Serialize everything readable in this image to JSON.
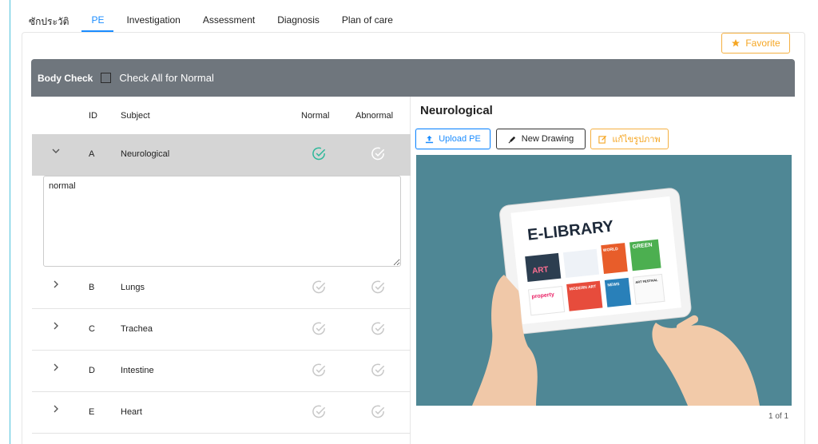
{
  "tabs": [
    {
      "label": "ซักประวัติ",
      "active": false
    },
    {
      "label": "PE",
      "active": true
    },
    {
      "label": "Investigation",
      "active": false
    },
    {
      "label": "Assessment",
      "active": false
    },
    {
      "label": "Diagnosis",
      "active": false
    },
    {
      "label": "Plan of care",
      "active": false
    }
  ],
  "favorite": {
    "label": "Favorite",
    "icon": "star-icon"
  },
  "body_check": {
    "title": "Body Check",
    "check_all_label": "Check All for Normal",
    "checked": false
  },
  "table": {
    "headers": {
      "id": "ID",
      "subject": "Subject",
      "normal": "Normal",
      "abnormal": "Abnormal"
    },
    "rows": [
      {
        "id": "A",
        "subject": "Neurological",
        "expanded": true,
        "normal": true,
        "abnormal": false,
        "note": "normal"
      },
      {
        "id": "B",
        "subject": "Lungs",
        "expanded": false,
        "normal": false,
        "abnormal": false
      },
      {
        "id": "C",
        "subject": "Trachea",
        "expanded": false,
        "normal": false,
        "abnormal": false
      },
      {
        "id": "D",
        "subject": "Intestine",
        "expanded": false,
        "normal": false,
        "abnormal": false
      },
      {
        "id": "E",
        "subject": "Heart",
        "expanded": false,
        "normal": false,
        "abnormal": false
      }
    ]
  },
  "right_panel": {
    "title": "Neurological",
    "upload_label": "Upload PE",
    "drawing_label": "New Drawing",
    "edit_label": "แก้ไขรูปภาพ",
    "image_title": "E-LIBRARY",
    "image_tiles": [
      "ART",
      "WORLD",
      "GREEN",
      "property",
      "MODERN ART",
      "NEWS",
      "ART FESTIVAL"
    ],
    "pager": "1 of 1"
  },
  "colors": {
    "accent": "#1a8cff",
    "warning": "#f5a623",
    "success": "#2eb89a",
    "bar": "#6f767d",
    "image_bg": "#4f8795"
  }
}
